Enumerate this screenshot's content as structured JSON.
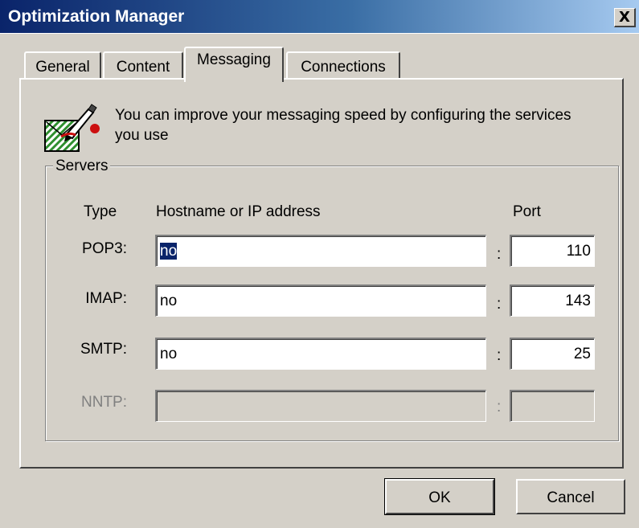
{
  "window": {
    "title": "Optimization Manager",
    "close_label": "X"
  },
  "tabs": [
    {
      "label": "General",
      "active": false
    },
    {
      "label": "Content",
      "active": false
    },
    {
      "label": "Messaging",
      "active": true
    },
    {
      "label": "Connections",
      "active": false
    }
  ],
  "info": {
    "icon": "edit-envelope-icon",
    "text": "You can improve your messaging speed by configuring the services you use"
  },
  "servers": {
    "group_label": "Servers",
    "headers": {
      "type": "Type",
      "hostname": "Hostname or IP address",
      "port": "Port"
    },
    "separator": ":",
    "rows": [
      {
        "type": "POP3:",
        "hostname": "no",
        "port": "110",
        "enabled": true,
        "selected": true
      },
      {
        "type": "IMAP:",
        "hostname": "no",
        "port": "143",
        "enabled": true,
        "selected": false
      },
      {
        "type": "SMTP:",
        "hostname": "no",
        "port": "25",
        "enabled": true,
        "selected": false
      },
      {
        "type": "NNTP:",
        "hostname": "",
        "port": "",
        "enabled": false,
        "selected": false
      }
    ]
  },
  "buttons": {
    "ok": "OK",
    "cancel": "Cancel"
  },
  "colors": {
    "titlebar_start": "#0a246a",
    "titlebar_end": "#a6caf0",
    "face": "#d4d0c8",
    "selection": "#0a246a"
  }
}
